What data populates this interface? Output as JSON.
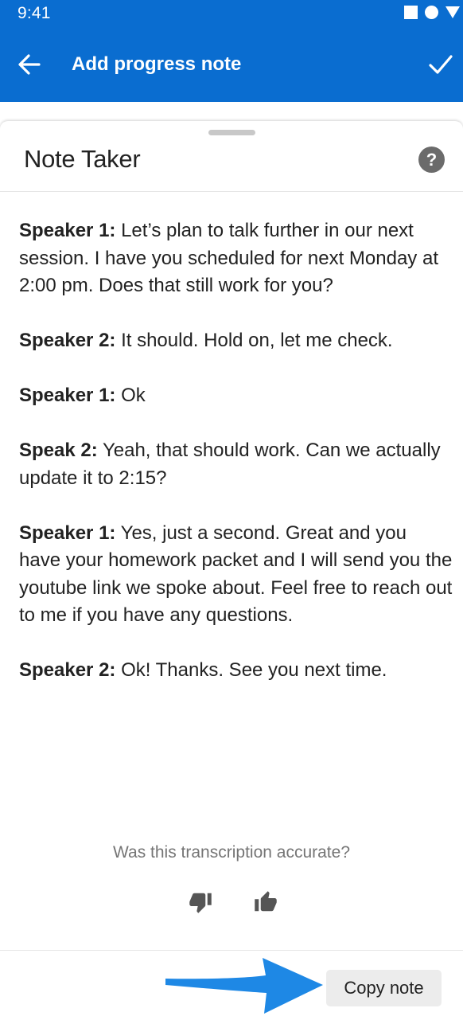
{
  "status_bar": {
    "time": "9:41"
  },
  "app_bar": {
    "title": "Add progress note",
    "back_icon": "arrow-left-icon",
    "confirm_icon": "checkmark-icon",
    "background_color": "#0a6dd0"
  },
  "sheet": {
    "title": "Note Taker",
    "help_icon_label": "?",
    "transcript": [
      {
        "speaker": "Speaker 1:",
        "text": " Let’s plan to talk further in our next session. I have you scheduled for next Monday at 2:00 pm. Does that still work for you?"
      },
      {
        "speaker": "Speaker 2:",
        "text": " It should. Hold on, let me check."
      },
      {
        "speaker": "Speaker 1:",
        "text": " Ok"
      },
      {
        "speaker": "Speak 2:",
        "text": " Yeah, that should work. Can we actually update it to 2:15?"
      },
      {
        "speaker": "Speaker 1:",
        "text": " Yes, just a second. Great and you have your homework packet and I will send you the youtube link we spoke about. Feel free to reach out to me if you have any questions."
      },
      {
        "speaker": "Speaker 2:",
        "text": " Ok! Thanks. See you next time."
      }
    ],
    "feedback": {
      "question": "Was this transcription accurate?",
      "thumbs_down_icon": "thumbs-down-icon",
      "thumbs_up_icon": "thumbs-up-icon"
    },
    "copy_button_label": "Copy note",
    "annotation_arrow_color": "#1e88e5"
  }
}
